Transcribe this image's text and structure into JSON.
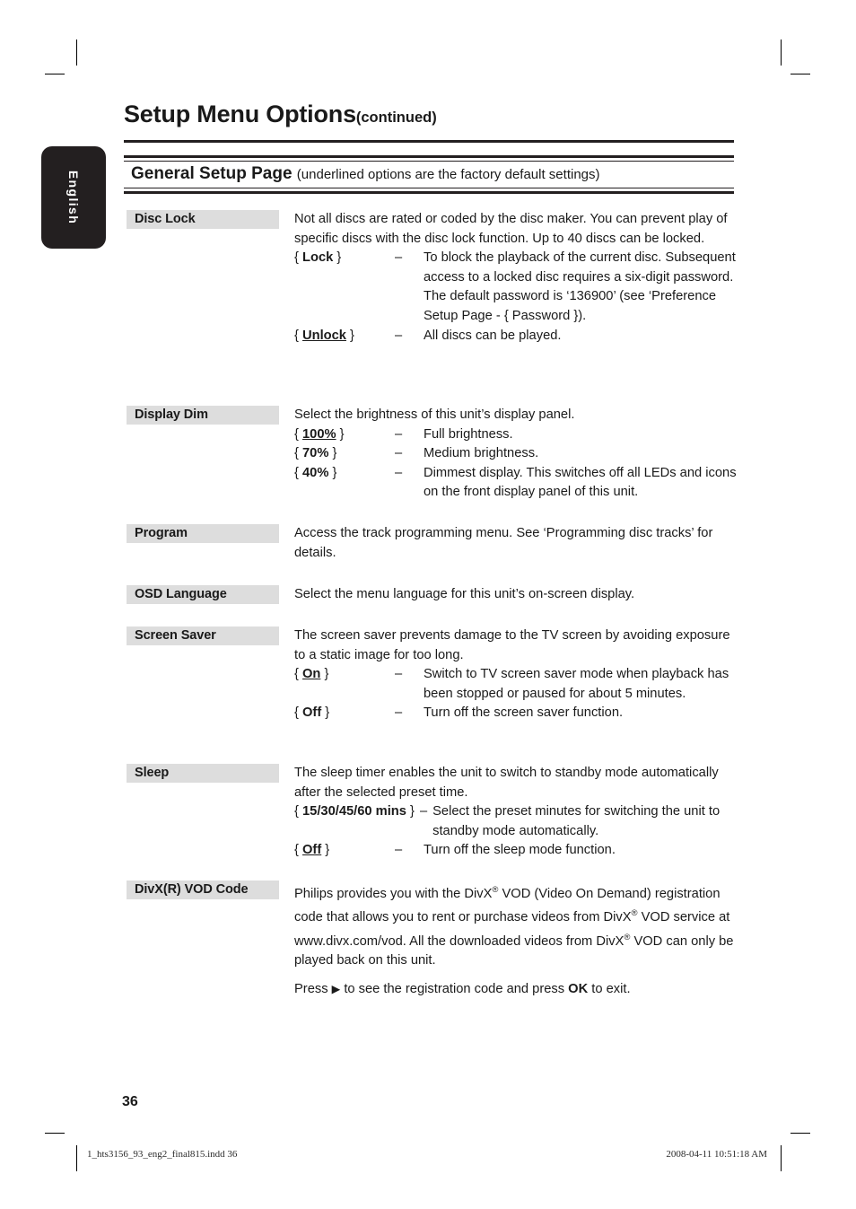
{
  "document": {
    "title": "Setup Menu Options",
    "title_suffix": "(continued)",
    "language_tab": "English",
    "section": {
      "heading": "General Setup Page",
      "note": "(underlined options are the factory default settings)"
    },
    "page_number": "36",
    "footer": {
      "file": "1_hts3156_93_eng2_final815.indd   36",
      "stamp": "2008-04-11   10:51:18 AM"
    }
  },
  "entries": [
    {
      "label": "Disc Lock",
      "intro": "Not all discs are rated or coded by the disc maker. You can prevent play of specific discs with the disc lock function. Up to 40 discs can be locked.",
      "options": [
        {
          "open": "{",
          "name": "Lock",
          "close": "}",
          "default": false,
          "dash": "–",
          "desc": "To block the playback of the current disc. Subsequent access to a locked disc requires a six-digit password. The default password is ‘136900’ (see ‘Preference Setup Page - { Password })."
        },
        {
          "open": "{",
          "name": "Unlock",
          "close": "}",
          "default": true,
          "dash": "–",
          "desc": "All discs can be played."
        }
      ]
    },
    {
      "label": "Display Dim",
      "intro": "Select the brightness of this unit’s display panel.",
      "options": [
        {
          "open": "{",
          "name": "100%",
          "close": "}",
          "default": true,
          "dash": "–",
          "desc": "Full brightness."
        },
        {
          "open": "{",
          "name": "70%",
          "close": "}",
          "default": false,
          "dash": "–",
          "desc": "Medium brightness."
        },
        {
          "open": "{",
          "name": "40%",
          "close": "}",
          "default": false,
          "dash": "–",
          "desc": "Dimmest display.  This switches off all LEDs and icons on the front display panel of this unit."
        }
      ]
    },
    {
      "label": "Program",
      "intro": "Access the track programming menu. See ‘Programming disc tracks’ for details.",
      "options": []
    },
    {
      "label": "OSD Language",
      "intro": "Select the menu language for this unit’s on-screen display.",
      "options": []
    },
    {
      "label": "Screen Saver",
      "intro": "The screen saver prevents damage to the TV screen by avoiding exposure to a static image for too long.",
      "options": [
        {
          "open": "{",
          "name": "On",
          "close": "}",
          "default": true,
          "dash": "–",
          "desc": "Switch to TV screen saver mode when playback has been stopped or paused for about 5 minutes."
        },
        {
          "open": "{",
          "name": "Off",
          "close": "}",
          "default": false,
          "dash": "–",
          "desc": "Turn off the screen saver function."
        }
      ]
    },
    {
      "label": "Sleep",
      "intro": "The sleep timer enables the unit to switch to standby mode automatically after the selected preset time.",
      "options": [
        {
          "open": "{",
          "name": "15/30/45/60 mins",
          "close": "}",
          "default": false,
          "dash": "–",
          "desc": "Select the preset minutes for switching the unit to standby mode automatically.",
          "wide": true
        },
        {
          "open": "{",
          "name": "Off",
          "close": "}",
          "default": true,
          "dash": "–",
          "desc": "Turn off the sleep mode function."
        }
      ]
    },
    {
      "label": "DivX(R) VOD Code",
      "paragraph_1_a": "Philips provides you with the DivX",
      "paragraph_1_b": " VOD (Video On Demand) registration code that allows you to rent or purchase videos from DivX",
      "paragraph_1_c": " VOD service at www.divx.com/vod. All the downloaded videos from DivX",
      "paragraph_1_d": " VOD can only be played back on this unit.",
      "registered_mark": "®",
      "paragraph_2_a": "Press ",
      "paragraph_2_arrow": "▶",
      "paragraph_2_b": " to see the registration code and press ",
      "paragraph_2_ok": "OK",
      "paragraph_2_c": " to exit."
    }
  ]
}
